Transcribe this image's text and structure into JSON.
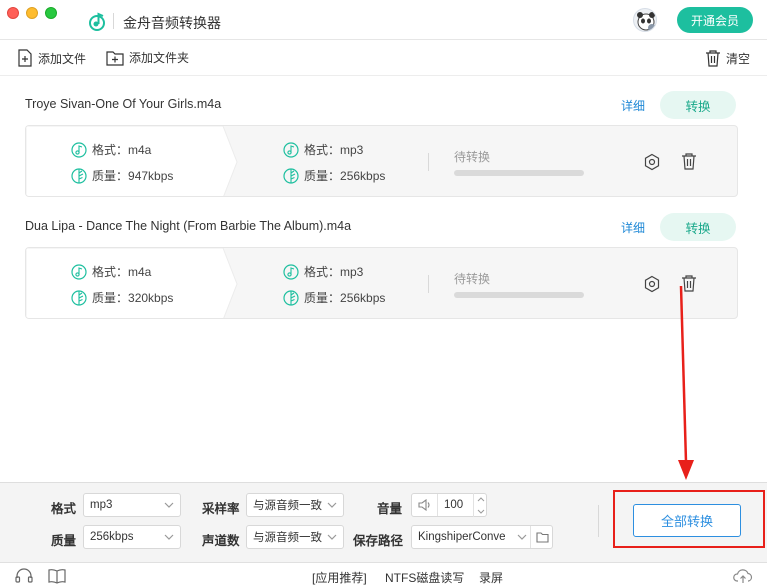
{
  "app": {
    "title": "金舟音频转换器",
    "vip_button": "开通会员"
  },
  "toolbar": {
    "add_file": "添加文件",
    "add_folder": "添加文件夹",
    "clear": "清空"
  },
  "labels": {
    "format_prefix": "格式：",
    "quality_prefix": "质量：",
    "detail": "详细",
    "convert": "转换"
  },
  "files": [
    {
      "name": "Troye Sivan-One Of Your Girls.m4a",
      "source_format": "m4a",
      "source_quality": "947kbps",
      "target_format": "mp3",
      "target_quality": "256kbps",
      "status": "待转换",
      "progress": 0
    },
    {
      "name": "Dua Lipa - Dance The Night (From Barbie The Album).m4a",
      "source_format": "m4a",
      "source_quality": "320kbps",
      "target_format": "mp3",
      "target_quality": "256kbps",
      "status": "待转换",
      "progress": 0
    }
  ],
  "settings": {
    "format_label": "格式",
    "format_value": "mp3",
    "quality_label": "质量",
    "quality_value": "256kbps",
    "sample_rate_label": "采样率",
    "sample_rate_value": "与源音频一致",
    "channels_label": "声道数",
    "channels_value": "与源音频一致",
    "volume_label": "音量",
    "volume_value": "100",
    "save_path_label": "保存路径",
    "save_path_value": "KingshiperConve",
    "convert_all": "全部转换"
  },
  "footer": {
    "app_recommend": "[应用推荐]",
    "ntfs": "NTFS磁盘读写",
    "record": "录屏"
  },
  "colors": {
    "accent_green": "#1dbf9f",
    "link_blue": "#1e88d6",
    "button_blue": "#2d8fe0",
    "annotation_red": "#e8201a"
  },
  "icons": [
    "app-logo-icon",
    "add-file-icon",
    "add-folder-icon",
    "trash-icon",
    "music-note-icon",
    "quality-leaf-icon",
    "gear-icon",
    "volume-icon",
    "folder-icon",
    "headset-icon",
    "book-icon",
    "upload-cloud-icon"
  ]
}
